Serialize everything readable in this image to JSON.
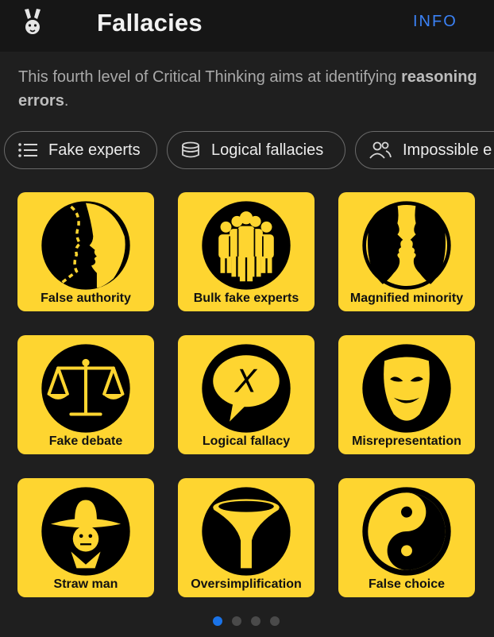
{
  "header": {
    "title": "Fallacies",
    "info_label": "INFO",
    "logo_icon": "rabbit-icon"
  },
  "intro": {
    "text": "This fourth level of Critical Thinking aims at identifying ",
    "bold": "reasoning errors",
    "end": "."
  },
  "chips": [
    {
      "label": "Fake experts",
      "icon": "list-icon"
    },
    {
      "label": "Logical fallacies",
      "icon": "stack-icon"
    },
    {
      "label": "Impossible e",
      "icon": "people-icon"
    }
  ],
  "cards": [
    {
      "label": "False authority",
      "icon": "face-profile-icon"
    },
    {
      "label": "Bulk fake experts",
      "icon": "crowd-icon"
    },
    {
      "label": "Magnified minority",
      "icon": "faces-vase-icon"
    },
    {
      "label": "Fake debate",
      "icon": "scales-icon"
    },
    {
      "label": "Logical fallacy",
      "icon": "speech-bubble-x-icon"
    },
    {
      "label": "Misrepresentation",
      "icon": "mask-icon"
    },
    {
      "label": "Straw man",
      "icon": "scarecrow-icon"
    },
    {
      "label": "Oversimplification",
      "icon": "funnel-icon"
    },
    {
      "label": "False choice",
      "icon": "yin-yang-icon"
    }
  ],
  "pagination": {
    "active_page": 1,
    "total_pages": 4
  },
  "colors": {
    "accent": "#1a73e8",
    "card": "#fed530",
    "background": "#1f1f1f"
  }
}
